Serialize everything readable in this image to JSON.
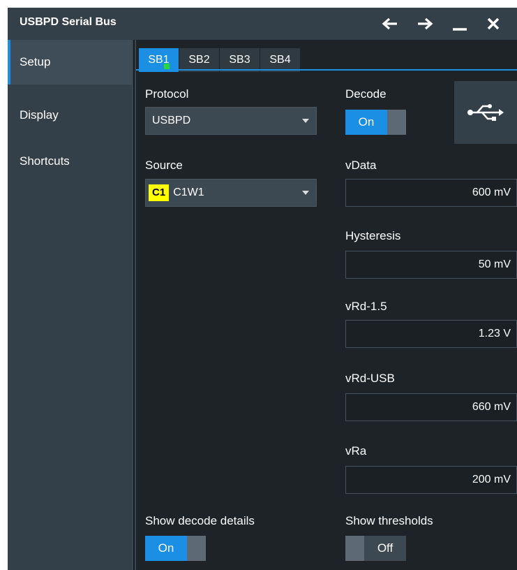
{
  "window": {
    "title": "USBPD Serial Bus"
  },
  "titlebar_icons": [
    "arrow-left-icon",
    "arrow-right-icon",
    "minimize-icon",
    "close-icon"
  ],
  "sidebar": {
    "items": [
      {
        "label": "Setup",
        "active": true
      },
      {
        "label": "Display",
        "active": false
      },
      {
        "label": "Shortcuts",
        "active": false
      }
    ]
  },
  "tabs": [
    {
      "label": "SB1",
      "active": true
    },
    {
      "label": "SB2",
      "active": false
    },
    {
      "label": "SB3",
      "active": false
    },
    {
      "label": "SB4",
      "active": false
    }
  ],
  "protocol": {
    "label": "Protocol",
    "value": "USBPD"
  },
  "source": {
    "label": "Source",
    "badge": "C1",
    "value": "C1W1",
    "badge_color": "#ffff00"
  },
  "decode": {
    "label": "Decode",
    "state": "On"
  },
  "usb_icon": "usb-icon",
  "fields": {
    "vdata": {
      "label": "vData",
      "value": "600 mV"
    },
    "hysteresis": {
      "label": "Hysteresis",
      "value": "50 mV"
    },
    "vrd15": {
      "label": "vRd-1.5",
      "value": "1.23 V"
    },
    "vrdusb": {
      "label": "vRd-USB",
      "value": "660 mV"
    },
    "vra": {
      "label": "vRa",
      "value": "200 mV"
    }
  },
  "show_decode_details": {
    "label": "Show decode details",
    "state": "On"
  },
  "show_thresholds": {
    "label": "Show thresholds",
    "state": "Off"
  },
  "colors": {
    "accent": "#1a8fe3",
    "background": "#1d2327",
    "panel": "#344049",
    "active_dot": "#2ad63a"
  }
}
